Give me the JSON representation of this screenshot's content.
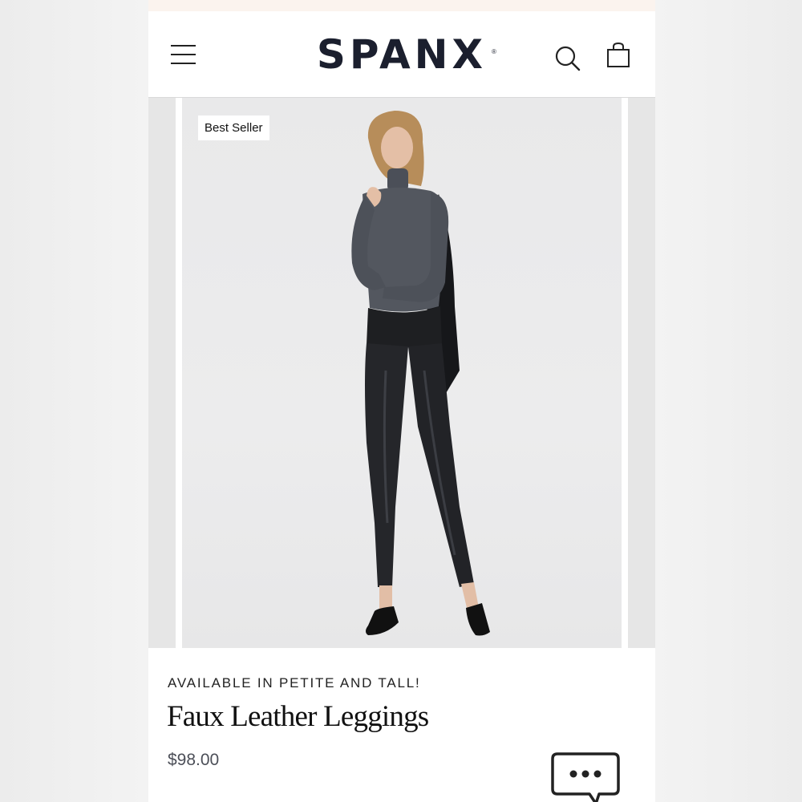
{
  "header": {
    "logo": "SPANX",
    "logo_mark": "®",
    "menu_icon": "hamburger-menu-icon",
    "search_icon": "search-icon",
    "bag_icon": "shopping-bag-icon"
  },
  "gallery": {
    "badge": "Best Seller"
  },
  "product": {
    "availability": "AVAILABLE IN PETITE AND TALL!",
    "title": "Faux Leather Leggings",
    "price": "$98.00"
  },
  "chat": {
    "icon": "chat-bubble-icon"
  },
  "colors": {
    "brand_navy": "#1b1f2e",
    "promo_strip": "#fbf3ee",
    "price_gray": "#4c4f58"
  }
}
